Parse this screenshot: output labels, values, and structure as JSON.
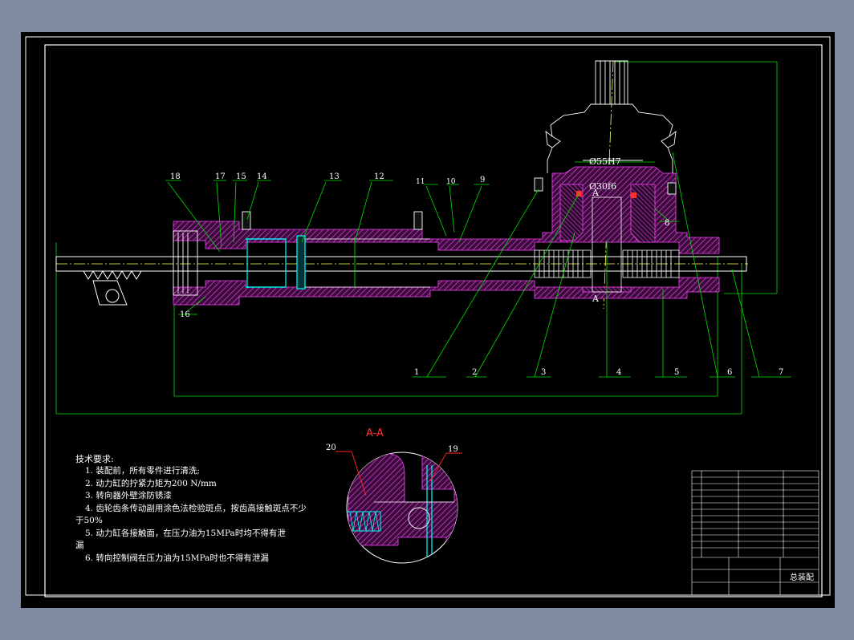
{
  "section": {
    "label": "A-A"
  },
  "dimensions": {
    "d55h7": "Ø55H7",
    "d30f6": "Ø30f6",
    "section_mark_top": "A",
    "section_mark_bottom": "A"
  },
  "part_numbers": {
    "top": [
      "18",
      "17",
      "15",
      "14",
      "13",
      "12",
      "11",
      "10",
      "9"
    ],
    "bottom": [
      "1",
      "2",
      "3",
      "4",
      "5",
      "6",
      "7"
    ],
    "side": [
      "16",
      "8"
    ],
    "section": [
      "20",
      "19"
    ]
  },
  "tech_requirements": {
    "title": "技术要求:",
    "items": [
      "1. 装配前，所有零件进行清洗;",
      "2. 动力缸的拧紧力矩为200 N/mm",
      "3. 转向器外壁涂防锈漆",
      "4. 齿轮齿条传动副用涂色法检验斑点，按齿高接触斑点不少",
      "于50%",
      "5. 动力缸各接触面，在压力油为15MPa时均不得有泄",
      "漏",
      "6. 转向控制阀在压力油为15MPa时也不得有泄漏"
    ]
  },
  "title_block": {
    "name": "总装配"
  }
}
